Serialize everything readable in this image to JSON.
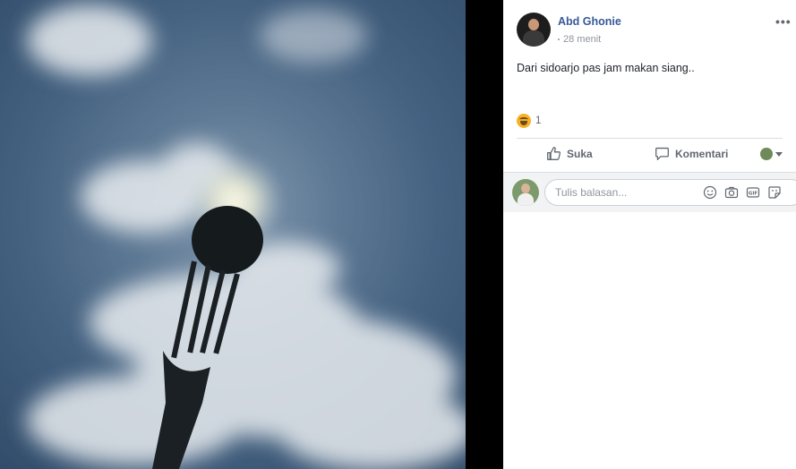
{
  "post": {
    "author": "Abd Ghonie",
    "time": "28 menit",
    "text": "Dari sidoarjo pas jam makan siang..",
    "reaction_count": "1"
  },
  "actions": {
    "like_label": "Suka",
    "comment_label": "Komentari"
  },
  "comment_box": {
    "placeholder": "Tulis balasan..."
  },
  "icons": [
    "haha-icon",
    "like-icon",
    "comment-icon",
    "smiley-icon",
    "camera-icon",
    "gif-icon",
    "sticker-icon",
    "more-icon"
  ]
}
